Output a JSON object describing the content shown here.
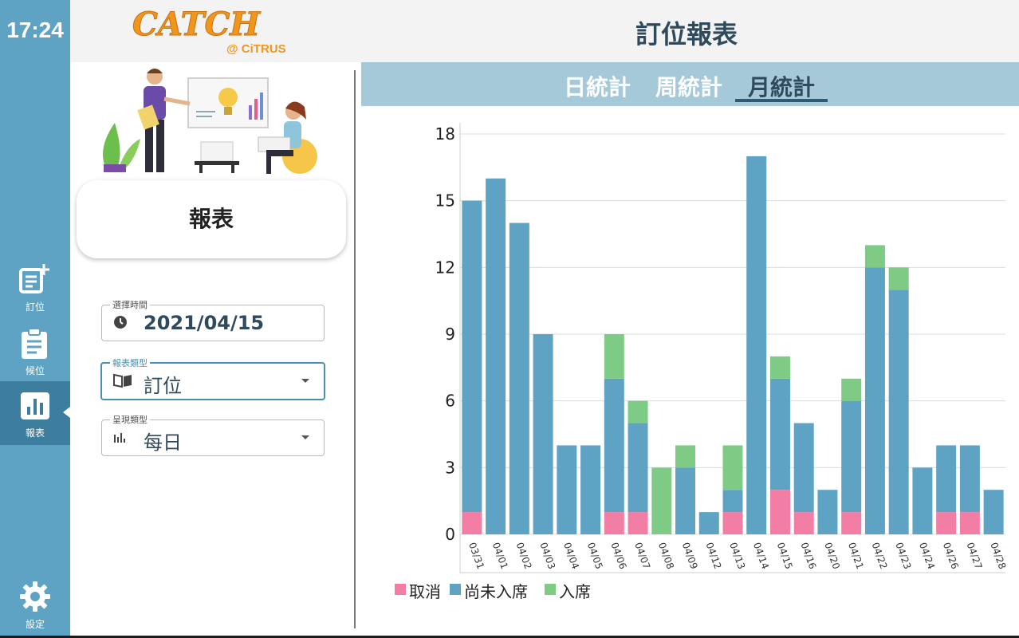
{
  "clock": "17:24",
  "nav": {
    "booking": "訂位",
    "waitlist": "候位",
    "report": "報表",
    "settings": "設定"
  },
  "logo": {
    "main": "CATCH",
    "sub": "@ CiTRUS"
  },
  "page_title": "訂位報表",
  "report_card": "報表",
  "fields": {
    "time": {
      "label": "選擇時間",
      "value": "2021/04/15"
    },
    "report_type": {
      "label": "報表類型",
      "value": "訂位"
    },
    "display_type": {
      "label": "呈現類型",
      "value": "每日"
    }
  },
  "tabs": [
    "日統計",
    "周統計",
    "月統計"
  ],
  "active_tab": 2,
  "colors": {
    "cancel": "#f27ea6",
    "pending": "#5fa3c4",
    "seated": "#7dcb85",
    "accent": "#2e4a5c"
  },
  "legend": [
    "取消",
    "尚未入席",
    "入席"
  ],
  "chart_data": {
    "type": "bar",
    "stacked": true,
    "categories": [
      "03/31",
      "04/01",
      "04/02",
      "04/03",
      "04/04",
      "04/05",
      "04/06",
      "04/07",
      "04/08",
      "04/09",
      "04/12",
      "04/13",
      "04/14",
      "04/15",
      "04/16",
      "04/20",
      "04/21",
      "04/22",
      "04/23",
      "04/24",
      "04/26",
      "04/27",
      "04/28"
    ],
    "series": [
      {
        "name": "取消",
        "color": "#f27ea6",
        "values": [
          1,
          0,
          0,
          0,
          0,
          0,
          1,
          1,
          0,
          0,
          0,
          1,
          0,
          2,
          1,
          0,
          1,
          0,
          0,
          0,
          1,
          1,
          0
        ]
      },
      {
        "name": "尚未入席",
        "color": "#5fa3c4",
        "values": [
          14,
          16,
          14,
          9,
          4,
          4,
          6,
          4,
          0,
          3,
          1,
          1,
          17,
          5,
          4,
          2,
          5,
          12,
          11,
          3,
          3,
          3,
          2
        ]
      },
      {
        "name": "入席",
        "color": "#7dcb85",
        "values": [
          0,
          0,
          0,
          0,
          0,
          0,
          2,
          1,
          3,
          1,
          0,
          2,
          0,
          1,
          0,
          0,
          1,
          1,
          1,
          0,
          0,
          0,
          0
        ]
      }
    ],
    "ylim": [
      0,
      18
    ],
    "yticks": [
      0,
      3,
      6,
      9,
      12,
      15,
      18
    ],
    "grid": true,
    "legend_position": "bottom-left"
  }
}
